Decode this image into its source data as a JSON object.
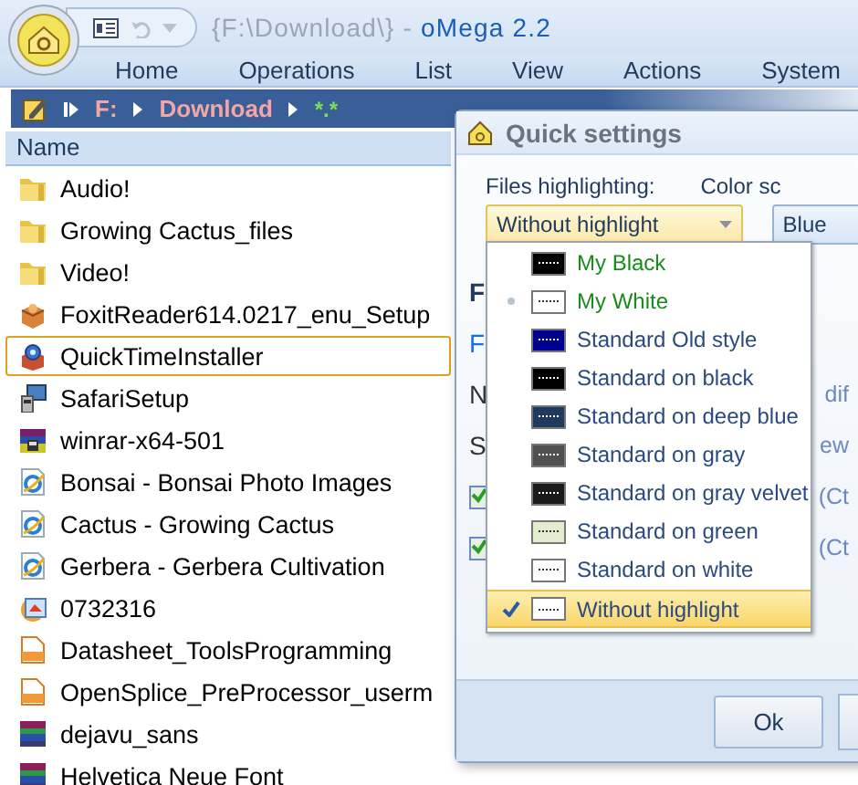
{
  "title_bar": {
    "path": "{F:\\Download\\}",
    "separator": " - ",
    "app": "oMega 2.2"
  },
  "menu": [
    "Home",
    "Operations",
    "List",
    "View",
    "Actions",
    "System"
  ],
  "path_bar": {
    "drive": "F:",
    "folder": "Download",
    "mask": "*.*"
  },
  "file_list": {
    "column": "Name",
    "rows": [
      {
        "name": "Audio!",
        "kind": "folder",
        "focused": false
      },
      {
        "name": "Growing Cactus_files",
        "kind": "folder",
        "focused": false
      },
      {
        "name": "Video!",
        "kind": "folder",
        "focused": false
      },
      {
        "name": "FoxitReader614.0217_enu_Setup",
        "kind": "installer",
        "focused": false
      },
      {
        "name": "QuickTimeInstaller",
        "kind": "app",
        "focused": true
      },
      {
        "name": "SafariSetup",
        "kind": "setup",
        "focused": false
      },
      {
        "name": "winrar-x64-501",
        "kind": "rarsetup",
        "focused": false
      },
      {
        "name": "Bonsai - Bonsai Photo Images",
        "kind": "web",
        "focused": false
      },
      {
        "name": "Cactus - Growing Cactus",
        "kind": "web",
        "focused": false
      },
      {
        "name": "Gerbera - Gerbera Cultivation",
        "kind": "web",
        "focused": false
      },
      {
        "name": "0732316",
        "kind": "image",
        "focused": false
      },
      {
        "name": "Datasheet_ToolsProgramming",
        "kind": "pdf",
        "focused": false
      },
      {
        "name": "OpenSplice_PreProcessor_userm",
        "kind": "pdf",
        "focused": false
      },
      {
        "name": "dejavu_sans",
        "kind": "archive",
        "focused": false
      },
      {
        "name": "Helvetica Neue Font",
        "kind": "archive",
        "focused": false
      }
    ]
  },
  "dialog": {
    "title": "Quick settings",
    "highlight_label": "Files highlighting:",
    "highlight_value": "Without highlight",
    "color_label": "Color sc",
    "color_value": "Blue",
    "background_rows": [
      {
        "kind": "heading",
        "left": "F"
      },
      {
        "kind": "link",
        "left": "F"
      },
      {
        "kind": "text",
        "left": "N",
        "right": "dif"
      },
      {
        "kind": "text",
        "left": "S",
        "right": "ew"
      },
      {
        "kind": "check",
        "checked": true,
        "right": "(Ct"
      },
      {
        "kind": "check",
        "checked": true,
        "right": "(Ct"
      }
    ],
    "options": [
      {
        "label": "My Black",
        "kind": "user",
        "color": "#000000",
        "bullet": false,
        "selected": false
      },
      {
        "label": "My White",
        "kind": "user",
        "color": "#ffffff",
        "bullet": true,
        "selected": false
      },
      {
        "label": "Standard Old style",
        "kind": "standard",
        "color": "#000090",
        "bullet": false,
        "selected": false
      },
      {
        "label": "Standard on black",
        "kind": "standard",
        "color": "#000000",
        "bullet": false,
        "selected": false
      },
      {
        "label": "Standard on deep blue",
        "kind": "standard",
        "color": "#1f3a5c",
        "bullet": false,
        "selected": false
      },
      {
        "label": "Standard on gray",
        "kind": "standard",
        "color": "#505050",
        "bullet": false,
        "selected": false
      },
      {
        "label": "Standard on gray velvet",
        "kind": "standard",
        "color": "#1a1a1a",
        "bullet": false,
        "selected": false
      },
      {
        "label": "Standard on green",
        "kind": "standard",
        "color": "#e4ecd0",
        "bullet": false,
        "selected": false
      },
      {
        "label": "Standard on white",
        "kind": "standard",
        "color": "#ffffff",
        "bullet": false,
        "selected": false
      },
      {
        "label": "Without highlight",
        "kind": "standard",
        "color": "#ffffff",
        "bullet": false,
        "selected": true
      }
    ],
    "buttons": [
      "Ok"
    ]
  }
}
